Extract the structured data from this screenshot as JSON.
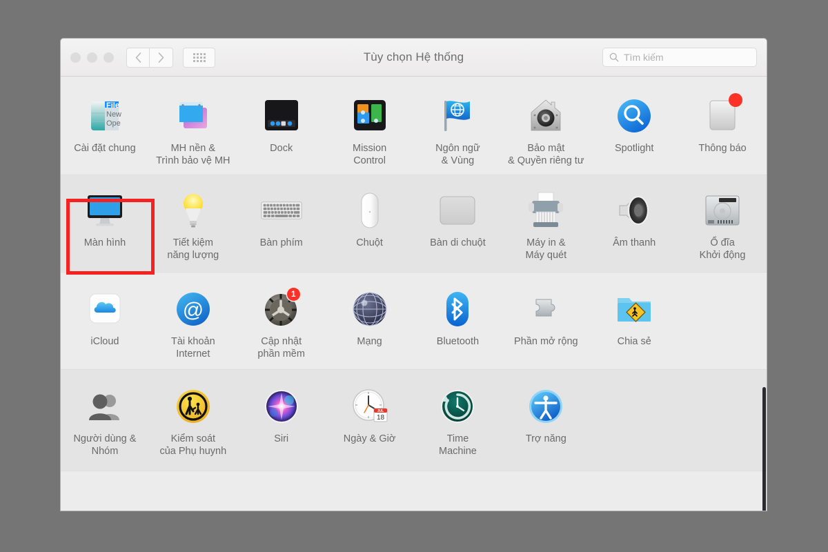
{
  "window": {
    "title": "Tùy chọn Hệ thống",
    "traffic_lights": [
      "close",
      "minimize",
      "zoom"
    ],
    "nav": {
      "back": "‹",
      "forward": "›",
      "grid": "grid-view"
    },
    "search": {
      "placeholder": "Tìm kiếm",
      "value": "",
      "icon": "search-icon"
    }
  },
  "highlight": {
    "target": "Màn hình",
    "color": "#f52222"
  },
  "rows": [
    {
      "items": [
        {
          "label": "Cài đặt chung",
          "icon": "general-icon",
          "badge": null
        },
        {
          "label": "MH nền &\nTrình bảo vệ MH",
          "icon": "desktop-screensaver-icon",
          "badge": null
        },
        {
          "label": "Dock",
          "icon": "dock-icon",
          "badge": null
        },
        {
          "label": "Mission\nControl",
          "icon": "mission-control-icon",
          "badge": null
        },
        {
          "label": "Ngôn ngữ\n& Vùng",
          "icon": "language-region-icon",
          "badge": null
        },
        {
          "label": "Bảo mật\n& Quyền riêng tư",
          "icon": "security-privacy-icon",
          "badge": null
        },
        {
          "label": "Spotlight",
          "icon": "spotlight-icon",
          "badge": null
        },
        {
          "label": "Thông báo",
          "icon": "notifications-icon",
          "badge": "dot"
        }
      ]
    },
    {
      "items": [
        {
          "label": "Màn hình",
          "icon": "displays-icon",
          "badge": null
        },
        {
          "label": "Tiết kiệm\nnăng lượng",
          "icon": "energy-saver-icon",
          "badge": null
        },
        {
          "label": "Bàn phím",
          "icon": "keyboard-icon",
          "badge": null
        },
        {
          "label": "Chuột",
          "icon": "mouse-icon",
          "badge": null
        },
        {
          "label": "Bàn di chuột",
          "icon": "trackpad-icon",
          "badge": null
        },
        {
          "label": "Máy in &\nMáy quét",
          "icon": "printers-scanners-icon",
          "badge": null
        },
        {
          "label": "Âm thanh",
          "icon": "sound-icon",
          "badge": null
        },
        {
          "label": "Ổ đĩa\nKhởi động",
          "icon": "startup-disk-icon",
          "badge": null
        }
      ]
    },
    {
      "items": [
        {
          "label": "iCloud",
          "icon": "icloud-icon",
          "badge": null
        },
        {
          "label": "Tài khoản\nInternet",
          "icon": "internet-accounts-icon",
          "badge": null
        },
        {
          "label": "Cập nhật\nphần mềm",
          "icon": "software-update-icon",
          "badge": "1"
        },
        {
          "label": "Mạng",
          "icon": "network-icon",
          "badge": null
        },
        {
          "label": "Bluetooth",
          "icon": "bluetooth-icon",
          "badge": null
        },
        {
          "label": "Phần mở rộng",
          "icon": "extensions-icon",
          "badge": null
        },
        {
          "label": "Chia sẻ",
          "icon": "sharing-icon",
          "badge": null
        }
      ]
    },
    {
      "items": [
        {
          "label": "Người dùng &\nNhóm",
          "icon": "users-groups-icon",
          "badge": null
        },
        {
          "label": "Kiểm soát\ncủa Phụ huynh",
          "icon": "parental-controls-icon",
          "badge": null
        },
        {
          "label": "Siri",
          "icon": "siri-icon",
          "badge": null
        },
        {
          "label": "Ngày & Giờ",
          "icon": "date-time-icon",
          "badge": null
        },
        {
          "label": "Time\nMachine",
          "icon": "time-machine-icon",
          "badge": null
        },
        {
          "label": "Trợ năng",
          "icon": "accessibility-icon",
          "badge": null
        }
      ]
    }
  ]
}
